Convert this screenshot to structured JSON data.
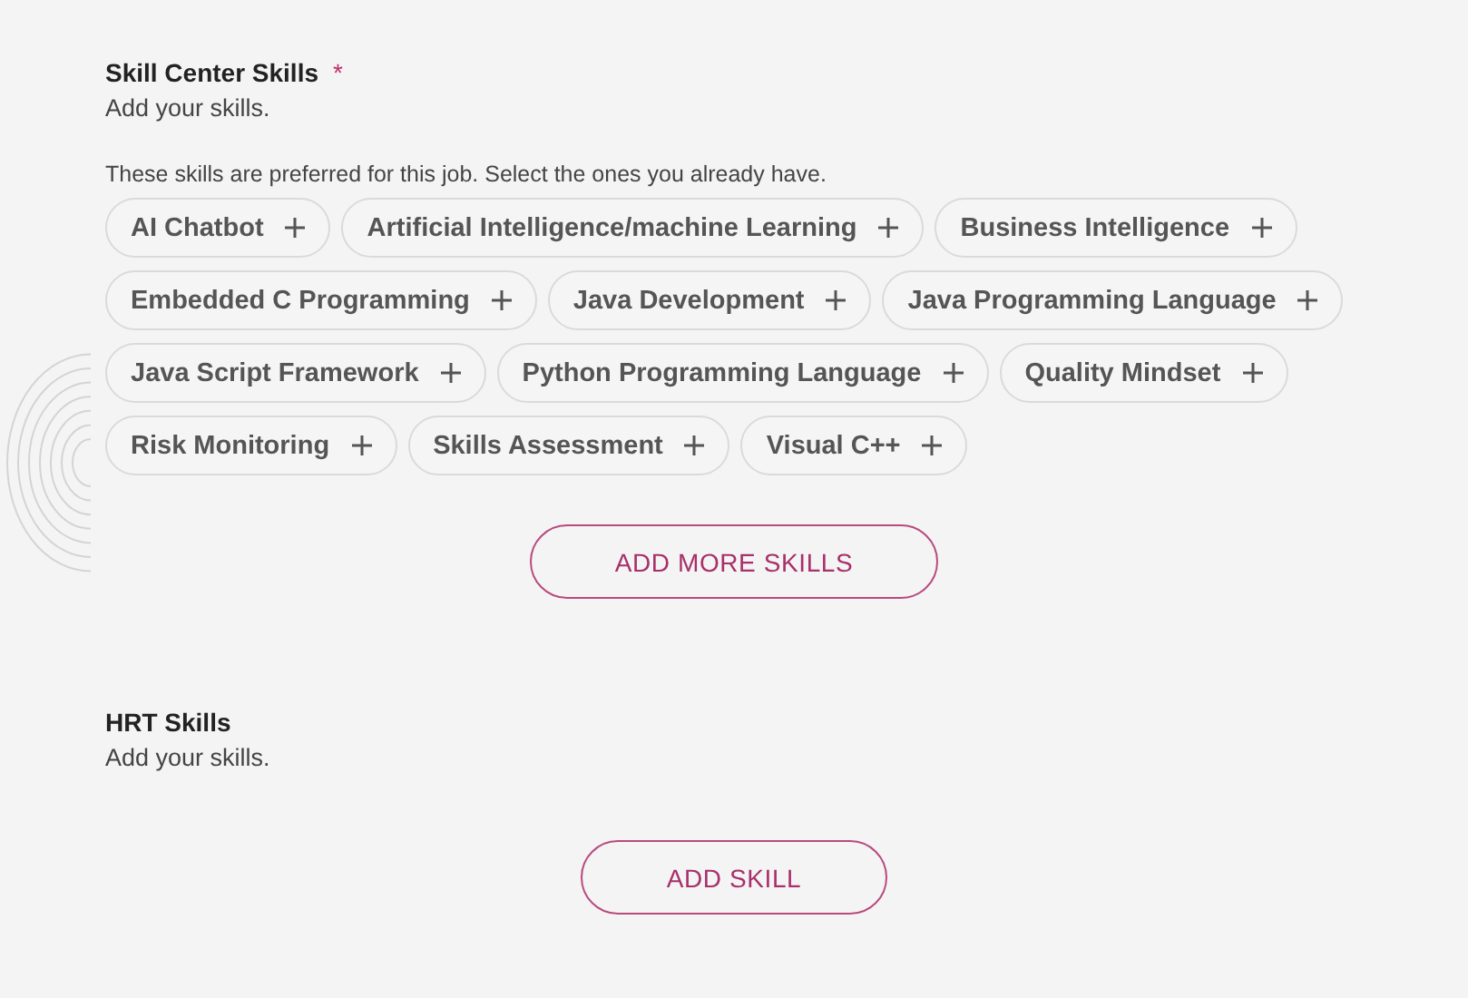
{
  "sections": [
    {
      "title": "Skill Center Skills",
      "required_mark": "*",
      "subtitle": "Add your skills.",
      "hint": "These skills are preferred for this job. Select the ones you already have.",
      "skills": [
        {
          "label": "AI Chatbot",
          "selected": false
        },
        {
          "label": "Artificial Intelligence/machine Learning",
          "selected": false
        },
        {
          "label": "Business Intelligence",
          "selected": false
        },
        {
          "label": "Embedded C Programming",
          "selected": false
        },
        {
          "label": "Java Development",
          "selected": false
        },
        {
          "label": "Java Programming Language",
          "selected": false
        },
        {
          "label": "Java Script Framework",
          "selected": false
        },
        {
          "label": "Python Programming Language",
          "selected": false
        },
        {
          "label": "Quality Mindset",
          "selected": false
        },
        {
          "label": "Risk Monitoring",
          "selected": false
        },
        {
          "label": "Skills Assessment",
          "selected": false
        },
        {
          "label": "Visual C++",
          "selected": false
        }
      ],
      "button": "ADD MORE SKILLS"
    },
    {
      "title": "HRT Skills",
      "subtitle": "Add your skills.",
      "button": "ADD SKILL"
    }
  ]
}
